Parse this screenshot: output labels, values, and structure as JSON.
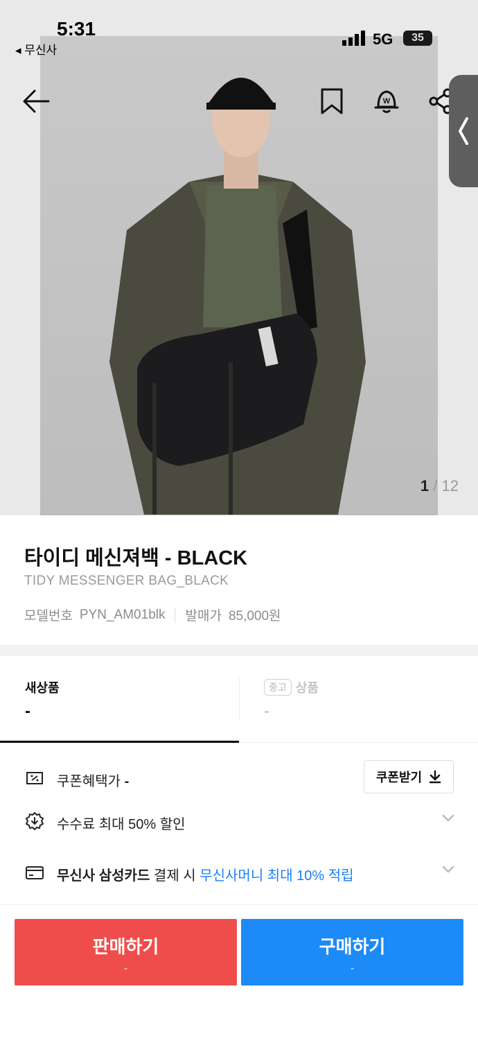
{
  "status_bar": {
    "time": "5:31",
    "back_app": "무신사",
    "network": "5G",
    "battery": "35"
  },
  "gallery": {
    "current": "1",
    "separator": "/",
    "total": "12"
  },
  "product": {
    "title": "타이디 메신져백 - BLACK",
    "english_name": "TIDY MESSENGER BAG_BLACK",
    "model_label": "모델번호",
    "model_value": "PYN_AM01blk",
    "release_label": "발매가",
    "release_value": "85,000원"
  },
  "tabs": [
    {
      "label": "새상품",
      "price": "-"
    },
    {
      "badge": "중고",
      "label": "상품",
      "price": "-"
    }
  ],
  "benefits": {
    "coupon_label": "쿠폰혜택가 ",
    "coupon_value": "-",
    "coupon_button": "쿠폰받기",
    "fee_discount": "수수료 최대 50% 할인",
    "card_bold": "무신사 삼성카드",
    "card_mid": " 결제 시 ",
    "card_blue": "무신사머니 최대 10% 적립"
  },
  "actions": {
    "sell_label": "판매하기",
    "sell_sub": "-",
    "buy_label": "구매하기",
    "buy_sub": "-"
  },
  "colors": {
    "sell": "#ef4d4b",
    "buy": "#1c8af7",
    "highlight": "#1a7ef7"
  }
}
